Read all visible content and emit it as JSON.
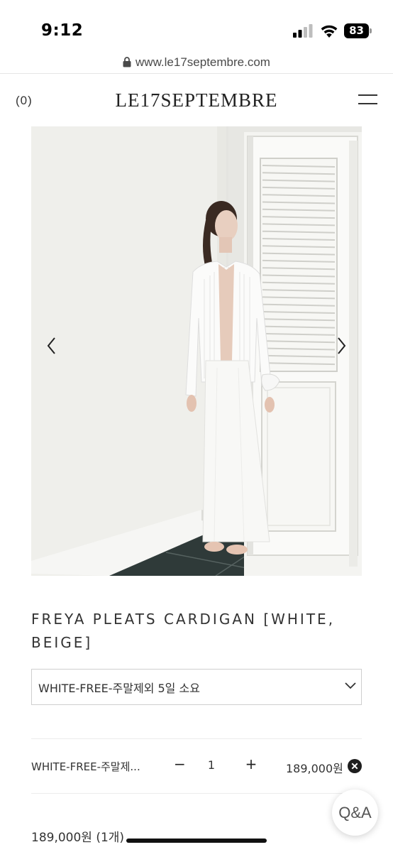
{
  "status_bar": {
    "time": "9:12",
    "battery": "83"
  },
  "browser": {
    "url": "www.le17septembre.com"
  },
  "header": {
    "cart_count": "(0)",
    "logo": "LE17SEPTEMBRE"
  },
  "product": {
    "title": "FREYA PLEATS CARDIGAN [WHITE, BEIGE]",
    "selected_option": "WHITE-FREE-주말제외 5일 소요",
    "line_item": {
      "name": "WHITE-FREE-주말제...",
      "quantity": "1",
      "minus_label": "−",
      "plus_label": "+",
      "price": "189,000원"
    },
    "total": "189,000원 (1개)"
  },
  "floating": {
    "qa_label": "Q&A"
  },
  "icons": {
    "lock": "lock-icon",
    "menu": "hamburger-menu-icon",
    "prev": "chevron-left-icon",
    "next": "chevron-right-icon",
    "dropdown": "chevron-down-icon",
    "remove": "close-circle-icon"
  }
}
